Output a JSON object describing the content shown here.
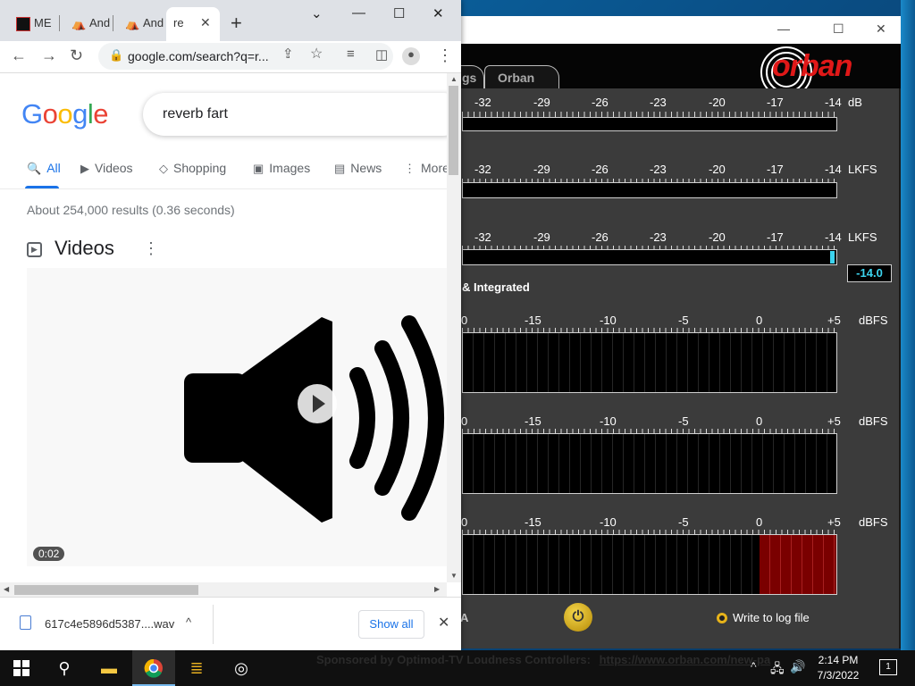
{
  "orban": {
    "tabs": [
      "gs",
      "Orban"
    ],
    "logo_text": "orban",
    "meters": [
      {
        "ticks": [
          "-32",
          "-29",
          "-26",
          "-23",
          "-20",
          "-17",
          "-14"
        ],
        "unit": "dB"
      },
      {
        "ticks": [
          "-32",
          "-29",
          "-26",
          "-23",
          "-20",
          "-17",
          "-14"
        ],
        "unit": "LKFS"
      },
      {
        "ticks": [
          "-32",
          "-29",
          "-26",
          "-23",
          "-20",
          "-17",
          "-14"
        ],
        "unit": "LKFS",
        "readout": "-14.0"
      }
    ],
    "section_label": "& Integrated",
    "peak_meters": [
      {
        "ticks": [
          "0",
          "-15",
          "-10",
          "-5",
          "0",
          "+5"
        ],
        "unit": "dBFS"
      },
      {
        "ticks": [
          "0",
          "-15",
          "-10",
          "-5",
          "0",
          "+5"
        ],
        "unit": "dBFS"
      },
      {
        "ticks": [
          "0",
          "-15",
          "-10",
          "-5",
          "0",
          "+5"
        ],
        "unit": "dBFS"
      }
    ],
    "a_label": "A",
    "write_log": "Write to log file",
    "sponsor": "Sponsored by Optimod-TV Loudness Controllers:",
    "sponsor_url": "https://www.orban.com/new-pa"
  },
  "chrome": {
    "tabs": [
      {
        "label": "ME"
      },
      {
        "label": "And"
      },
      {
        "label": "And"
      },
      {
        "label": "re"
      }
    ],
    "url": "google.com/search?q=r...",
    "logo": "Google",
    "query": "reverb fart",
    "search_tabs": [
      "All",
      "Videos",
      "Shopping",
      "Images",
      "News",
      "More"
    ],
    "results_count": "About 254,000 results (0.36 seconds)",
    "videos_heading": "Videos",
    "video_duration": "0:02",
    "download_filename": "617c4e5896d5387....wav",
    "show_all": "Show all"
  },
  "taskbar": {
    "time": "2:14 PM",
    "date": "7/3/2022",
    "notification_count": "1"
  },
  "colors": {
    "google_blue": "#4285F4",
    "google_red": "#EA4335",
    "google_yellow": "#FBBC05",
    "google_green": "#34A853",
    "orban_red": "#e01818",
    "readout_cyan": "#3cd3ee",
    "link_blue": "#1a73e8"
  }
}
